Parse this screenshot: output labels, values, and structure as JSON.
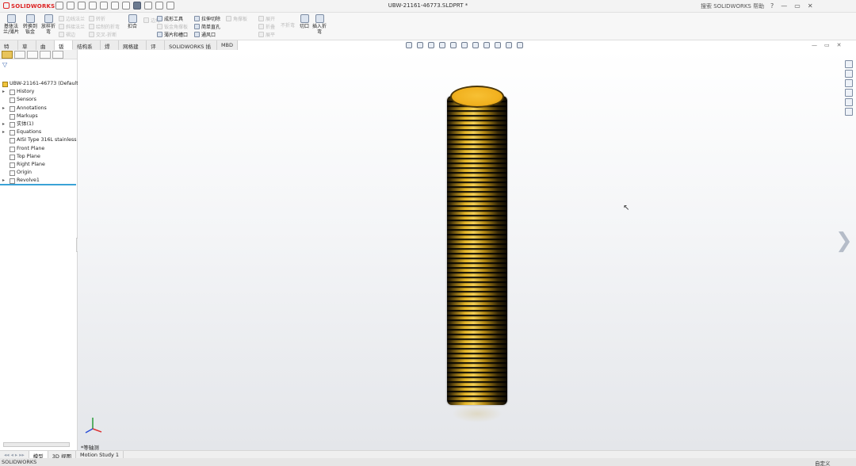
{
  "app": {
    "logo": "SOLIDWORKS",
    "document_title": "UBW-21161-46773.SLDPRT *",
    "help_search": "搜索 SOLIDWORKS 帮助"
  },
  "window_controls": [
    "?",
    "—",
    "▭",
    "✕"
  ],
  "command_manager": {
    "big": [
      {
        "label": "基体法兰/薄片",
        "enabled": true
      },
      {
        "label": "转换到钣金",
        "enabled": true
      },
      {
        "label": "放样折弯",
        "enabled": true
      },
      {
        "label": "边线法兰",
        "enabled": false
      },
      {
        "label": "展开",
        "enabled": false
      },
      {
        "label": "扣合",
        "enabled": true
      },
      {
        "label": "角撑板",
        "enabled": false
      },
      {
        "label": "切口",
        "enabled": true
      },
      {
        "label": "插入折弯",
        "enabled": true
      }
    ],
    "small": [
      {
        "label": "斜接法兰",
        "enabled": false
      },
      {
        "label": "褶边",
        "enabled": false
      },
      {
        "label": "转折",
        "enabled": false
      },
      {
        "label": "绘制的折弯",
        "enabled": false
      },
      {
        "label": "交叉-折断",
        "enabled": false
      },
      {
        "label": "成形工具",
        "enabled": true
      },
      {
        "label": "钣金角撑板",
        "enabled": false
      },
      {
        "label": "薄片和槽口",
        "enabled": true
      },
      {
        "label": "拉伸切除",
        "enabled": true
      },
      {
        "label": "简单直孔",
        "enabled": true
      },
      {
        "label": "通风口",
        "enabled": true
      },
      {
        "label": "边角",
        "enabled": false
      },
      {
        "label": "折叠",
        "enabled": false
      },
      {
        "label": "展平",
        "enabled": false
      },
      {
        "label": "不折弯",
        "enabled": false
      }
    ]
  },
  "tabs": [
    "特征",
    "草图",
    "曲面",
    "钣金",
    "结构系统",
    "焊件",
    "网格建模",
    "评估",
    "SOLIDWORKS 插件",
    "MBD"
  ],
  "active_tab": "钣金",
  "feature_tree": {
    "root": "UBW-21161-46773 (Default)",
    "items": [
      {
        "label": "History",
        "expandable": true
      },
      {
        "label": "Sensors",
        "expandable": false
      },
      {
        "label": "Annotations",
        "expandable": true
      },
      {
        "label": "Markups",
        "expandable": false
      },
      {
        "label": "实体(1)",
        "expandable": true
      },
      {
        "label": "Equations",
        "expandable": true
      },
      {
        "label": "AISI Type 316L stainless ste",
        "expandable": false
      },
      {
        "label": "Front Plane",
        "expandable": false
      },
      {
        "label": "Top Plane",
        "expandable": false
      },
      {
        "label": "Right Plane",
        "expandable": false
      },
      {
        "label": "Origin",
        "expandable": false
      },
      {
        "label": "Revolve1",
        "expandable": true
      }
    ]
  },
  "viewport": {
    "view_label": "*等轴测"
  },
  "bottom_tabs": [
    "模型",
    "3D 视图",
    "Motion Study 1"
  ],
  "active_bottom_tab": "模型",
  "status": {
    "left": "SOLIDWORKS",
    "right": "自定义"
  }
}
